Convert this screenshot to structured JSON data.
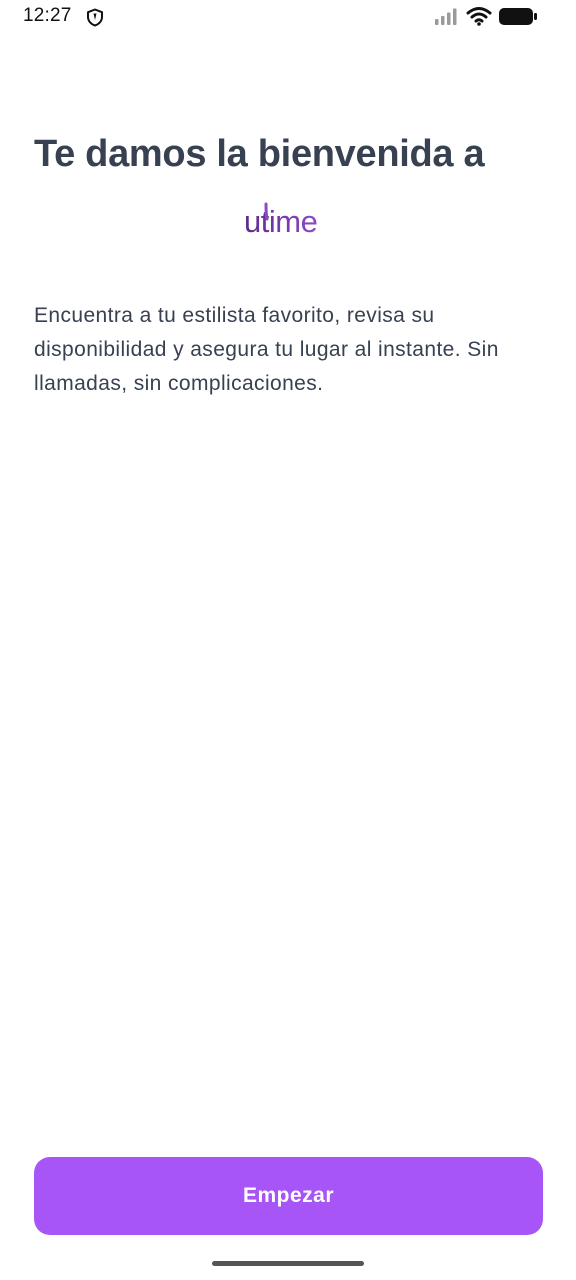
{
  "status_bar": {
    "time": "12:27",
    "icons": [
      "shield-icon",
      "signal-icon",
      "wifi-icon",
      "battery-icon"
    ]
  },
  "welcome": {
    "title": "Te damos la bienvenida a",
    "logo_text": "utime",
    "description": "Encuentra a tu estilista favorito, revisa su disponibilidad y asegura tu lugar al instante. Sin llamadas, sin complicaciones."
  },
  "actions": {
    "start_label": "Empezar"
  },
  "colors": {
    "title": "#374151",
    "body_text": "#374151",
    "brand": "#6b2f95",
    "button": "#a855f7",
    "button_text": "#ffffff"
  }
}
